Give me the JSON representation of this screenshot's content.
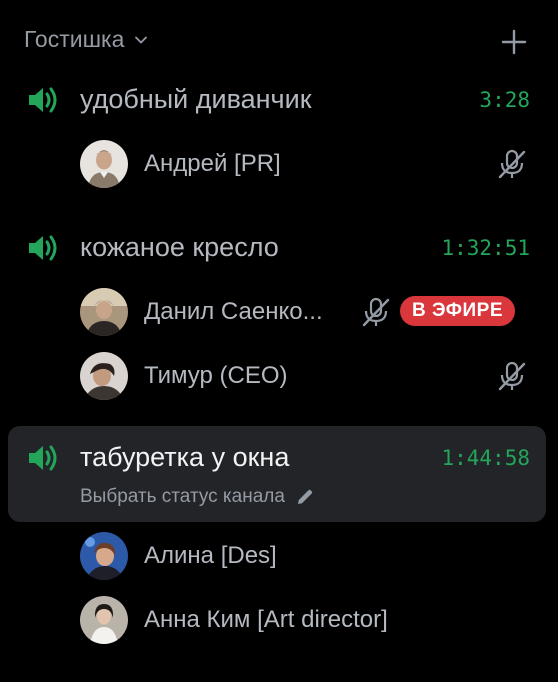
{
  "category": {
    "title": "Гостишка",
    "chevron_icon": "chevron-down-icon",
    "add_icon": "plus-icon"
  },
  "colors": {
    "background": "#000000",
    "active_row": "#232428",
    "timer_green": "#23a55a",
    "speaker_green": "#23a55a",
    "live_red": "#da373c",
    "text_muted": "#949ba4",
    "text_normal": "#b5bac1"
  },
  "channels": [
    {
      "name": "удобный диванчик",
      "time": "3:28",
      "icon": "speaker-icon",
      "users": [
        {
          "name": "Андрей [PR]",
          "muted": true,
          "live": false
        }
      ]
    },
    {
      "name": "кожаное кресло",
      "time": "1:32:51",
      "icon": "speaker-icon",
      "users": [
        {
          "name": "Данил Саенко...",
          "muted": true,
          "live": true,
          "live_label": "В ЭФИРЕ"
        },
        {
          "name": "Тимур (CEO)",
          "muted": true,
          "live": false
        }
      ]
    },
    {
      "name": "табуретка у окна",
      "time": "1:44:58",
      "icon": "speaker-icon",
      "active": true,
      "status_text": "Выбрать статус канала",
      "status_icon": "pencil-icon",
      "users": [
        {
          "name": "Алина [Des]",
          "muted": false,
          "live": false
        },
        {
          "name": "Анна Ким [Art director]",
          "muted": false,
          "live": false
        }
      ]
    }
  ]
}
